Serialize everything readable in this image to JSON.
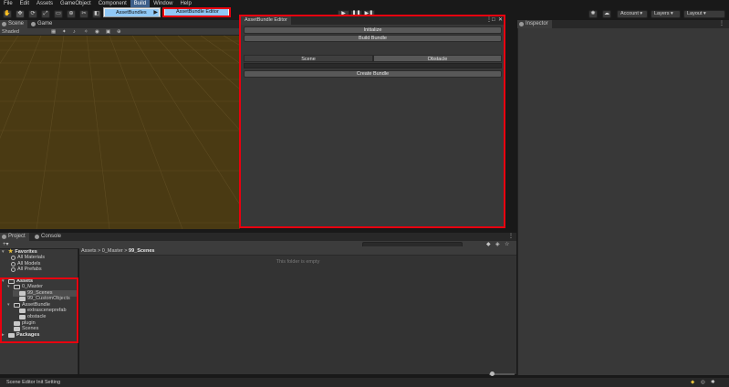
{
  "menubar": {
    "items": [
      "File",
      "Edit",
      "Assets",
      "GameObject",
      "Component",
      "Build",
      "Window",
      "Help"
    ]
  },
  "build_menu": {
    "item": "AssetBundles",
    "arrow": "▶",
    "submenu_item": "AssetBundle Editor"
  },
  "toolbar": {
    "account": "Account",
    "layers": "Layers",
    "layout": "Layout"
  },
  "scene_tabs": {
    "scene": "Scene",
    "game": "Game",
    "shading": "Shaded"
  },
  "editor_window": {
    "title": "AssetBundle Editor",
    "initialize": "Initialize",
    "build_bundle": "Build Bundle",
    "seg_scene": "Scene",
    "seg_obstacle": "Obstacle",
    "create_bundle": "Create Bundle"
  },
  "inspector": {
    "tab": "Inspector"
  },
  "project": {
    "tab_project": "Project",
    "tab_console": "Console",
    "favorites": "Favorites",
    "fav_items": [
      "All Materials",
      "All Models",
      "All Prefabs"
    ],
    "assets": "Assets",
    "master": "0_Master",
    "scenes99": "99_Scenes",
    "custom99": "99_CustomObjects",
    "assetbundle": "AssetBundle",
    "extrasceneprefab": "extrasceneprefab",
    "obstacle": "obstacle",
    "plugin": "plugin",
    "scenes": "Scenes",
    "packages": "Packages",
    "breadcrumb": [
      "Assets",
      "0_Master",
      "99_Scenes"
    ],
    "empty_text": "This folder is empty"
  },
  "statusbar": {
    "text": "Scene Editor Init Setting"
  },
  "colors": {
    "accent_red": "#e8000f",
    "menu_highlight": "#90c8f6",
    "scene_bg": "#4a3a13"
  }
}
